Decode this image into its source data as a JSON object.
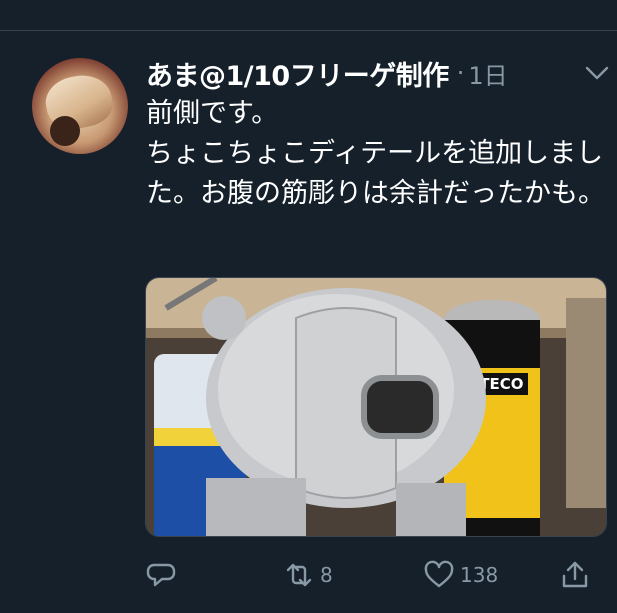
{
  "tweet": {
    "display_name": "あま@1/10フリーゲ制作",
    "separator": "·",
    "timestamp": "1日",
    "text": "前側です。\nちょこちょこディテールを追加しました。お腹の筋彫りは余計だったかも。",
    "media_label": "ALTECO",
    "actions": {
      "reply_icon": "reply-icon",
      "retweet_icon": "retweet-icon",
      "retweet_count": "8",
      "like_icon": "heart-icon",
      "like_count": "138",
      "share_icon": "share-icon"
    }
  },
  "colors": {
    "background": "#15202b",
    "secondary_text": "#8899a6",
    "divider": "#38444d"
  }
}
